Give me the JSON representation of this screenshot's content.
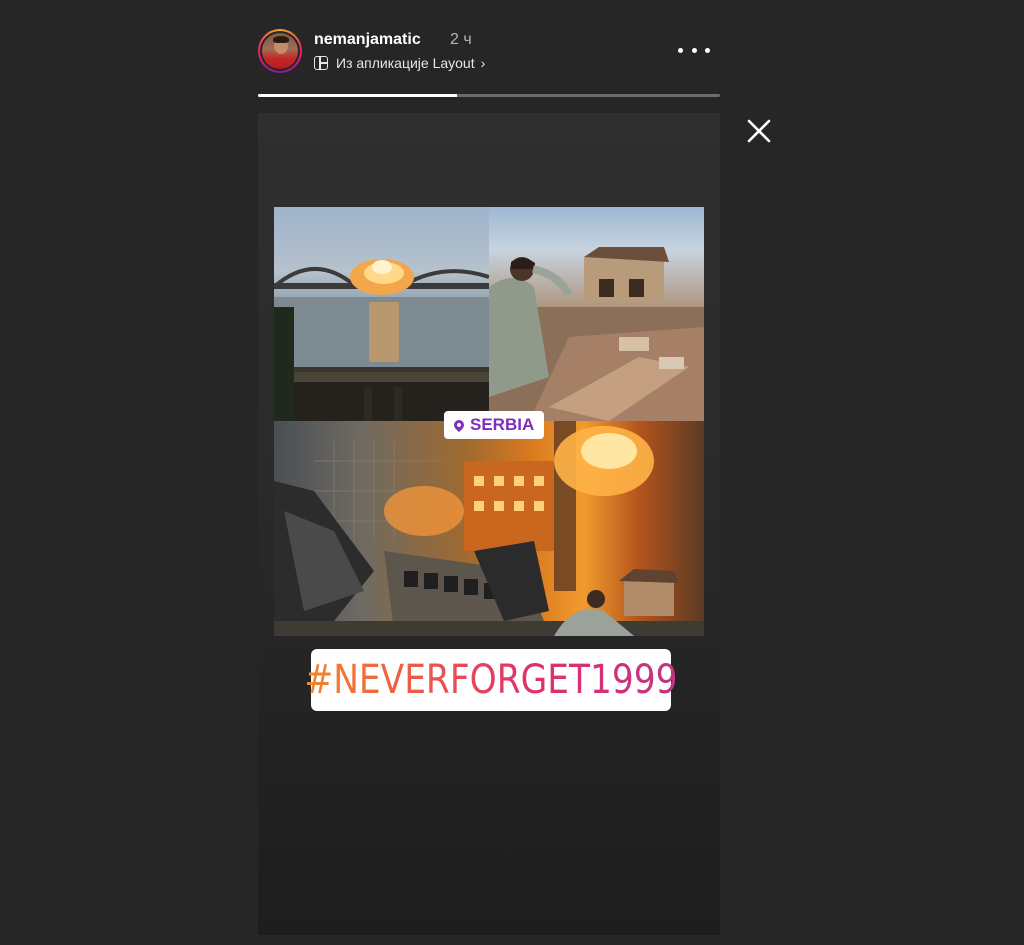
{
  "header": {
    "username": "nemanjamatic",
    "time": "2 ч",
    "source_label": "Из апликације Layout",
    "chevron": "›",
    "avatar_icon": "profile-avatar",
    "more_icon": "more-horizontal-icon"
  },
  "progress": {
    "current_segment_fraction": 0.43
  },
  "close_icon": "close-icon",
  "story": {
    "location_sticker": "SERBIA",
    "hashtag_sticker": "#NEVERFORGET1999"
  },
  "colors": {
    "background": "#262626",
    "location_accent": "#7b2fbf",
    "hashtag_gradient_start": "#f58529",
    "hashtag_gradient_end": "#c13584"
  }
}
